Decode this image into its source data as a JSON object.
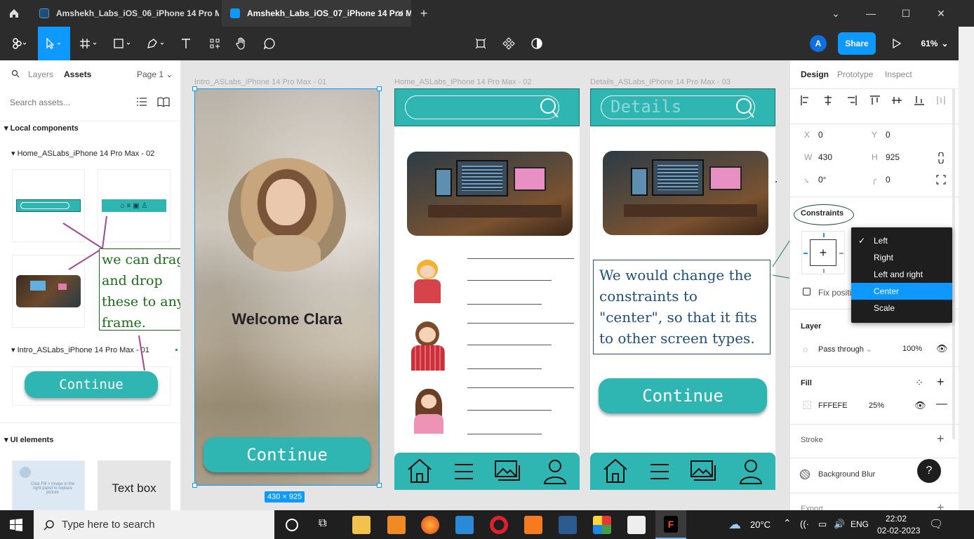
{
  "window": {
    "tabs": [
      {
        "title": "Amshekh_Labs_iOS_06_iPhone 14 Pro Ma"
      },
      {
        "title": "Amshekh_Labs_iOS_07_iPhone 14 Pro M"
      }
    ]
  },
  "toolbar": {
    "avatar": "A",
    "share": "Share",
    "zoom": "61%"
  },
  "left_panel": {
    "tabs": [
      "Layers",
      "Assets"
    ],
    "page": "Page 1",
    "search_placeholder": "Search assets...",
    "local_components": "Local components",
    "group1": "Home_ASLabs_iPhone 14 Pro Max - 02",
    "group2": "Intro_ASLabs_iPhone 14 Pro Max - 01",
    "continue": "Continue",
    "ui_elements": "UI elements",
    "placeholder_text": "Click Fill > Image in the right panel to replace picture",
    "textbox": "Text box",
    "annotation": "we can drag and drop these to any frame."
  },
  "canvas": {
    "frame1_title": "Intro_ASLabs_iPhone 14 Pro Max - 01",
    "frame2_title": "Home_ASLabs_iPhone 14 Pro Max - 02",
    "frame3_title": "Details_ASLabs_iPhone 14 Pro Max - 03",
    "welcome": "Welcome  Clara",
    "continue": "Continue",
    "size_badge": "430 × 925",
    "details_placeholder": "Details",
    "note": "We would change the constraints to \"center\", so that it fits to other screen types."
  },
  "right_panel": {
    "tabs": [
      "Design",
      "Prototype",
      "Inspect"
    ],
    "x_label": "X",
    "x": "0",
    "y_label": "Y",
    "y": "0",
    "w_label": "W",
    "w": "430",
    "h_label": "H",
    "h": "925",
    "rotation": "0°",
    "radius": "0",
    "constraints": "Constraints",
    "fix_position": "Fix positi",
    "layer": "Layer",
    "blend": "Pass through",
    "opacity": "100%",
    "fill": "Fill",
    "fill_hex": "FFFEFE",
    "fill_opacity": "25%",
    "stroke": "Stroke",
    "bg_blur": "Background Blur",
    "export": "Export",
    "help": "?",
    "dropdown": [
      "Left",
      "Right",
      "Left and right",
      "Center",
      "Scale"
    ],
    "dropdown_checked": "Left",
    "dropdown_highlight": "Center"
  },
  "taskbar": {
    "search_placeholder": "Type here to search",
    "temperature": "20°C",
    "language": "ENG",
    "time": "22:02",
    "date": "02-02-2023"
  },
  "colors": {
    "accent": "#0d99ff",
    "teal": "#2fb6b2",
    "annotation_green": "#1a6b1a",
    "note_blue": "#1f4e79"
  }
}
